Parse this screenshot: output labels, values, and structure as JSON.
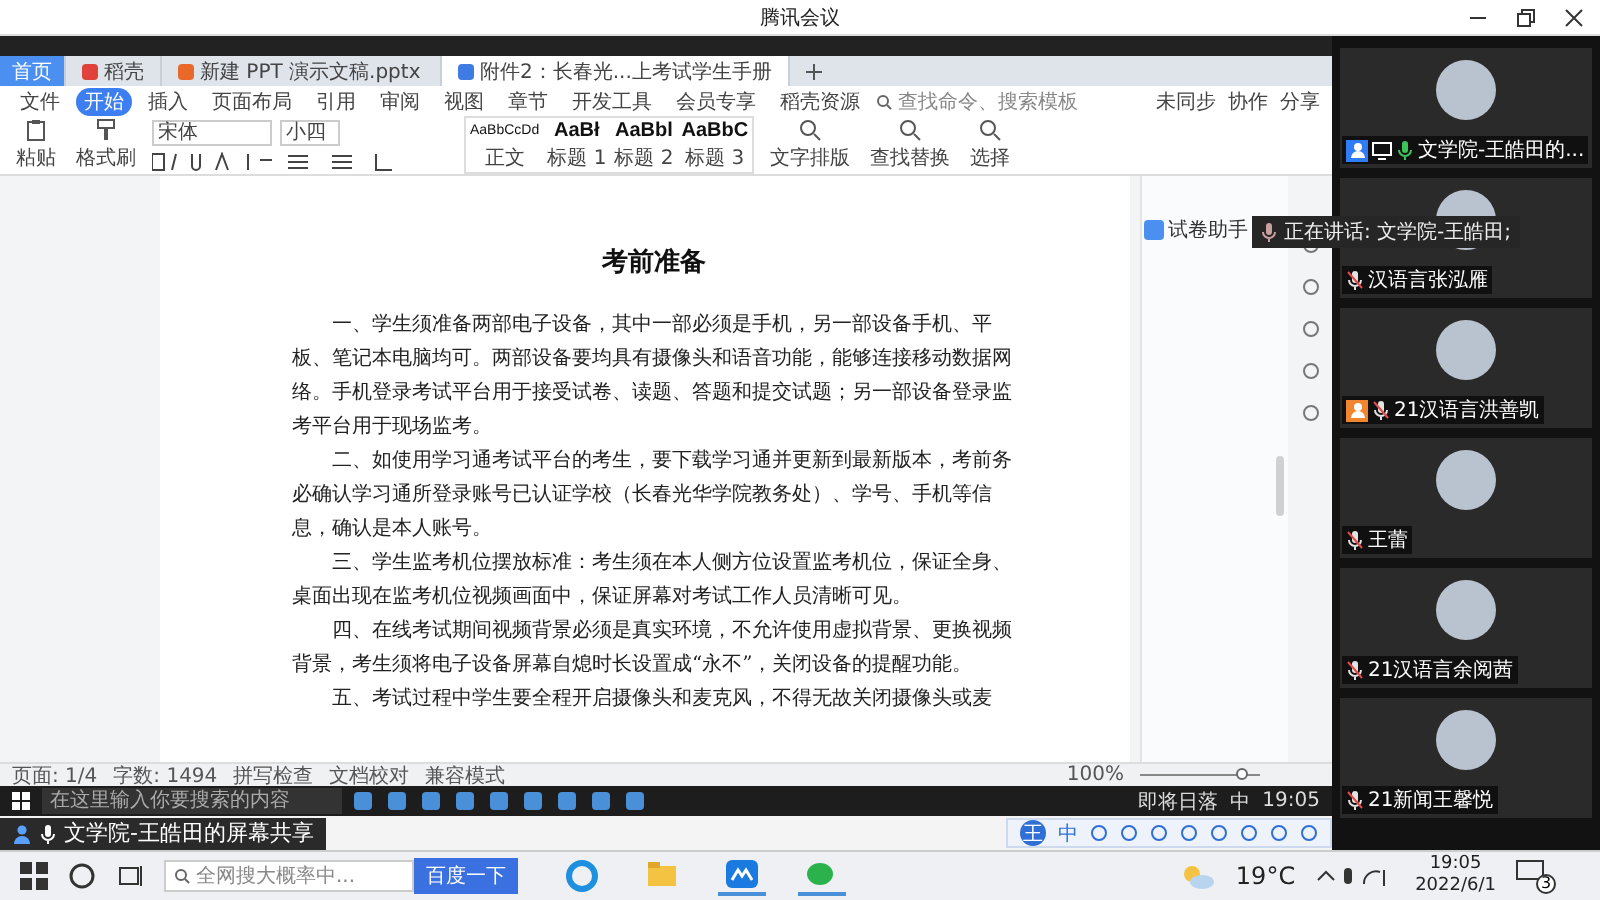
{
  "window": {
    "title": "腾讯会议"
  },
  "wps_tabs": [
    {
      "label": "首页",
      "selected": false,
      "kind": "home"
    },
    {
      "label": "稻壳",
      "selected": false,
      "kind": "docer"
    },
    {
      "label": "新建 PPT 演示文稿.pptx",
      "selected": false,
      "kind": "ppt"
    },
    {
      "label": "附件2：长春光...上考试学生手册",
      "selected": true,
      "kind": "doc"
    }
  ],
  "menu": [
    {
      "label": "文件",
      "selected": false
    },
    {
      "label": "开始",
      "selected": true
    },
    {
      "label": "插入",
      "selected": false
    },
    {
      "label": "页面布局",
      "selected": false
    },
    {
      "label": "引用",
      "selected": false
    },
    {
      "label": "审阅",
      "selected": false
    },
    {
      "label": "视图",
      "selected": false
    },
    {
      "label": "章节",
      "selected": false
    },
    {
      "label": "开发工具",
      "selected": false
    },
    {
      "label": "会员专享",
      "selected": false
    },
    {
      "label": "稻壳资源",
      "selected": false
    }
  ],
  "command_search": {
    "placeholder": "查找命令、搜索模板"
  },
  "menu_right": [
    "未同步",
    "协作",
    "分享"
  ],
  "ribbon": {
    "paste": "粘贴",
    "format_painter": "格式刷",
    "font": "宋体",
    "size": "小四",
    "styles": [
      {
        "sample": "AaBbCcDd",
        "name": "正文"
      },
      {
        "sample": "AaBł",
        "name": "标题 1"
      },
      {
        "sample": "AaBbl",
        "name": "标题 2"
      },
      {
        "sample": "AaBbC",
        "name": "标题 3"
      }
    ],
    "tools": [
      "文字排版",
      "查找替换",
      "选择"
    ]
  },
  "document": {
    "title": "考前准备",
    "paragraphs": [
      "一、学生须准备两部电子设备，其中一部必须是手机，另一部设备手机、平板、笔记本电脑均可。两部设备要均具有摄像头和语音功能，能够连接移动数据网络。手机登录考试平台用于接受试卷、读题、答题和提交试题；另一部设备登录监考平台用于现场监考。",
      "二、如使用学习通考试平台的考生，要下载学习通并更新到最新版本，考前务必确认学习通所登录账号已认证学校（长春光华学院教务处）、学号、手机等信息，确认是本人账号。",
      "三、学生监考机位摆放标准：考生须在本人侧方位设置监考机位，保证全身、桌面出现在监考机位视频画面中，保证屏幕对考试工作人员清晰可见。",
      "四、在线考试期间视频背景必须是真实环境，不允许使用虚拟背景、更换视频背景，考生须将电子设备屏幕自熄时长设置成“永不”，关闭设备的提醒功能。",
      "五、考试过程中学生要全程开启摄像头和麦克风，不得无故关闭摄像头或麦"
    ]
  },
  "side_panel": {
    "label": "试卷助手"
  },
  "status_bar": {
    "items": [
      "页面: 1/4",
      "字数: 1494",
      "拼写检查",
      "文档校对",
      "兼容模式"
    ],
    "zoom": "100%",
    "level": 0.85
  },
  "remote_taskbar": {
    "search": {
      "placeholder": "在这里输入你要搜索的内容"
    },
    "weather": "即将日落",
    "ime": "中",
    "time": "19:05"
  },
  "share_label": "文学院-王皓田的屏幕共享",
  "ime_bar": {
    "logo": "王",
    "mode": "中"
  },
  "speaking": "正在讲话: 文学院-王皓田;",
  "participants": [
    {
      "name": "文学院-王皓田的...",
      "color": "#2f7cf6",
      "sharing": true,
      "mic_on": true
    },
    {
      "name": "汉语言张泓雁",
      "sharing": false,
      "mic_on": false
    },
    {
      "name": "21汉语言洪善凯",
      "color": "#f0862f",
      "sharing": false,
      "mic_on": false
    },
    {
      "name": "王蕾",
      "sharing": false,
      "mic_on": false
    },
    {
      "name": "21汉语言余阅茜",
      "sharing": false,
      "mic_on": false
    },
    {
      "name": "21新闻王馨悦",
      "sharing": false,
      "mic_on": false
    }
  ],
  "taskbar": {
    "search": {
      "placeholder": "全网搜大概率中..."
    },
    "search_button": "百度一下",
    "temperature": "19°C",
    "time": "19:05",
    "date": "2022/6/1",
    "notifications": "3"
  }
}
